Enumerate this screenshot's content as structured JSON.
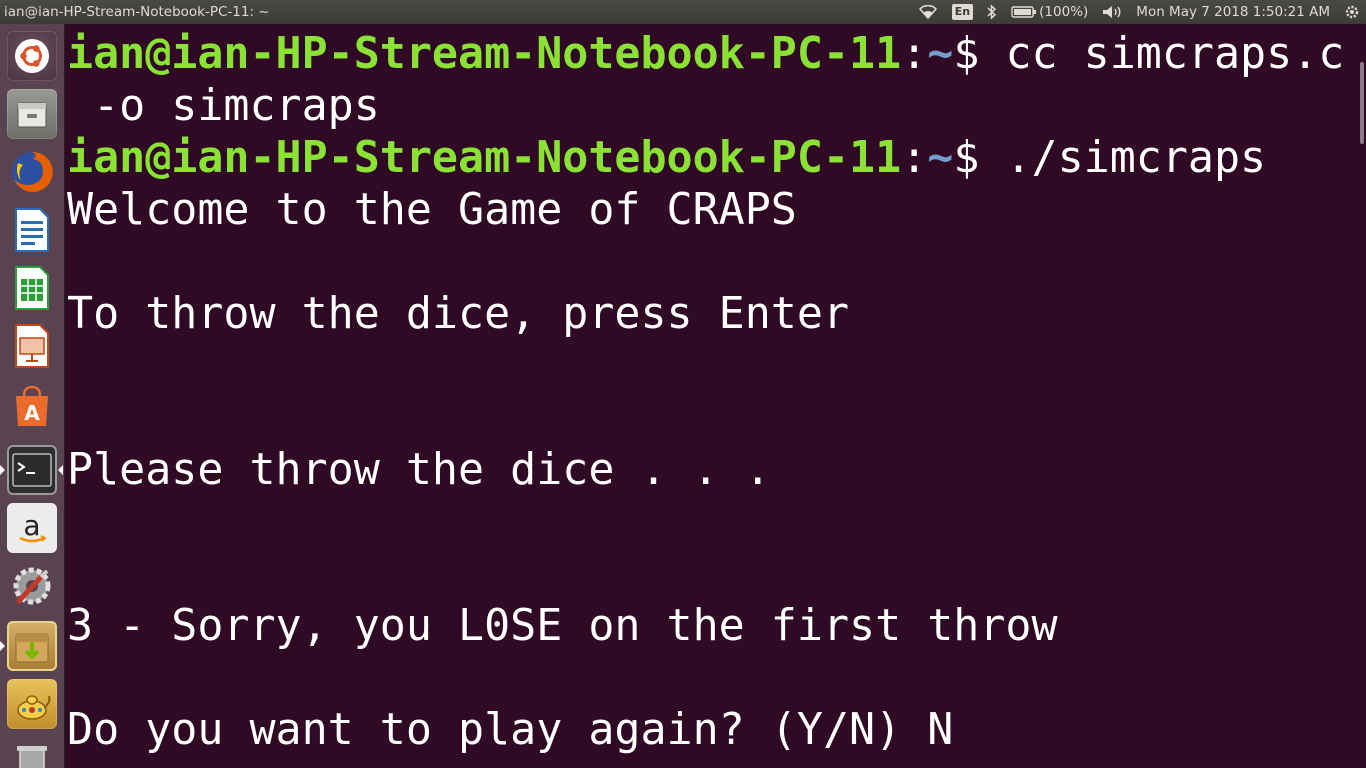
{
  "top_panel": {
    "window_title": "ian@ian-HP-Stream-Notebook-PC-11: ~",
    "keyboard_layout": "En",
    "battery": "(100%)",
    "datetime": "Mon May 7 2018 1:50:21 AM",
    "icons": [
      "wifi-icon",
      "keyboard-icon",
      "bluetooth-icon",
      "battery-icon",
      "volume-icon",
      "gear-icon"
    ]
  },
  "launcher": {
    "items": [
      {
        "name": "ubuntu-dash",
        "icon": "ubuntu-logo-icon",
        "color": "#d9532b"
      },
      {
        "name": "files",
        "icon": "files-icon",
        "color": "#8a8a84"
      },
      {
        "name": "firefox",
        "icon": "firefox-icon",
        "color": "#e66000"
      },
      {
        "name": "libreoffice-writer",
        "icon": "writer-icon",
        "color": "#2a6ebb"
      },
      {
        "name": "libreoffice-calc",
        "icon": "calc-icon",
        "color": "#2f9c3a"
      },
      {
        "name": "libreoffice-impress",
        "icon": "impress-icon",
        "color": "#c0471a"
      },
      {
        "name": "ubuntu-software",
        "icon": "software-center-icon",
        "color": "#e96c2c"
      },
      {
        "name": "terminal",
        "icon": "terminal-icon",
        "color": "#2f2f2f",
        "active": true
      },
      {
        "name": "amazon",
        "icon": "amazon-icon",
        "color": "#ececec"
      },
      {
        "name": "system-settings",
        "icon": "settings-icon",
        "color": "#8b8b8b"
      },
      {
        "name": "software-updater",
        "icon": "updater-icon",
        "color": "#c9a34f"
      },
      {
        "name": "genie-app",
        "icon": "lamp-icon",
        "color": "#d8a93a"
      },
      {
        "name": "trash",
        "icon": "trash-icon",
        "color": "#7f7f7f"
      }
    ]
  },
  "terminal": {
    "colors": {
      "background": "#300a24",
      "user": "#8ae234",
      "path": "#729fcf",
      "text": "#ffffff"
    },
    "lines": [
      {
        "user": "ian@ian-HP-Stream-Notebook-PC-11",
        "colon": ":",
        "path": "~",
        "cmd": "$ cc simcraps.c"
      },
      {
        "text": " -o simcraps"
      },
      {
        "user": "ian@ian-HP-Stream-Notebook-PC-11",
        "colon": ":",
        "path": "~",
        "cmd": "$ ./simcraps"
      },
      {
        "text": "Welcome to the Game of CRAPS"
      },
      {
        "text": ""
      },
      {
        "text": "To throw the dice, press Enter"
      },
      {
        "text": ""
      },
      {
        "text": ""
      },
      {
        "text": "Please throw the dice . . ."
      },
      {
        "text": ""
      },
      {
        "text": ""
      },
      {
        "text": "3 - Sorry, you L0SE on the first throw"
      },
      {
        "text": ""
      },
      {
        "text": "Do you want to play again? (Y/N) N"
      }
    ]
  }
}
